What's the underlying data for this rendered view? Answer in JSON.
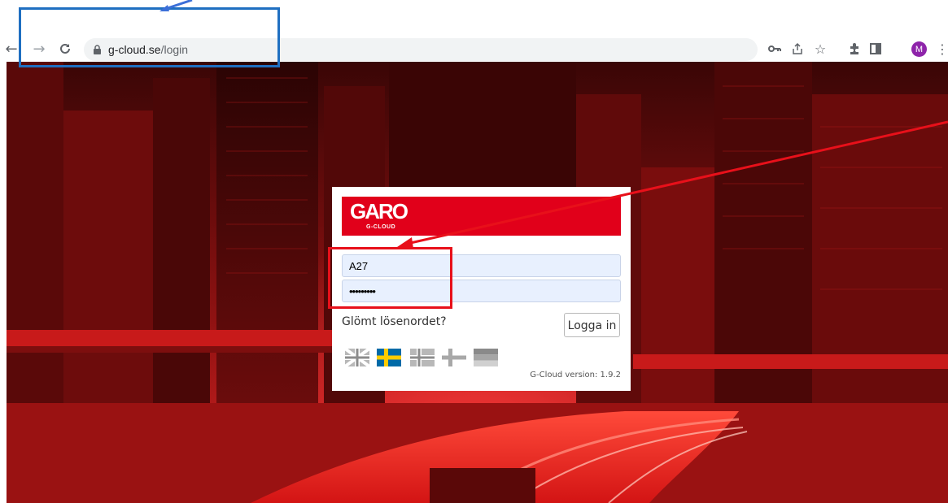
{
  "browser": {
    "url_host": "g-cloud.se",
    "url_path": "/login",
    "icons": [
      "back-icon",
      "forward-icon",
      "reload-icon",
      "lock-icon",
      "key-icon",
      "share-icon",
      "star-icon",
      "extensions-icon",
      "sidepanel-icon",
      "menu-icon"
    ],
    "profile_initial": "M"
  },
  "login": {
    "logo_text": "GARO",
    "logo_subtext": "G-CLOUD",
    "username_value": "A27",
    "password_value": "•••••••••",
    "forgot_label": "Glömt lösenordet?",
    "submit_label": "Logga in",
    "version_text": "G-Cloud version: 1.9.2",
    "languages": [
      "english-flag",
      "swedish-flag",
      "norwegian-flag",
      "finnish-flag",
      "german-flag"
    ]
  },
  "colors": {
    "brand_red": "#e1001a",
    "annotation_blue": "#1f6fc1",
    "annotation_red": "#e8101a"
  }
}
